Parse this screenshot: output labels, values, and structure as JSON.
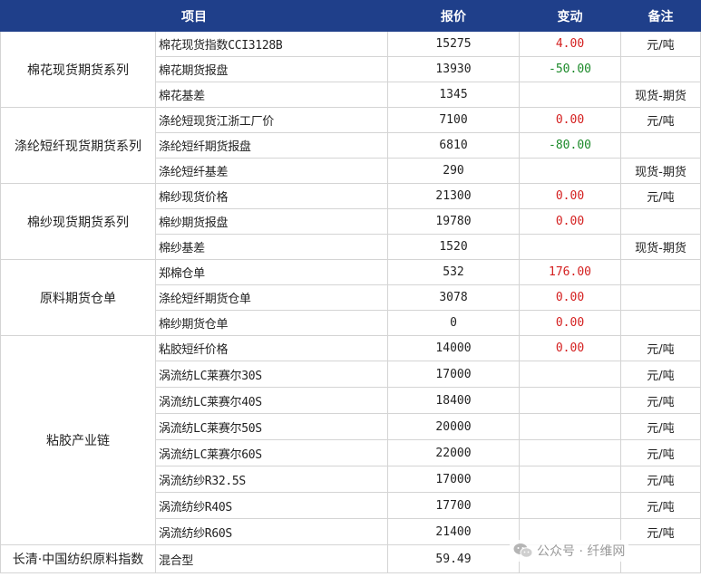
{
  "headers": {
    "item": "项目",
    "price": "报价",
    "change": "变动",
    "note": "备注"
  },
  "groups": [
    {
      "name": "棉花现货期货系列",
      "rows": [
        {
          "item": "棉花现货指数CCI3128B",
          "price": "15275",
          "change": "4.00",
          "change_color": "red",
          "note": "元/吨"
        },
        {
          "item": "棉花期货报盘",
          "price": "13930",
          "change": "-50.00",
          "change_color": "green",
          "note": ""
        },
        {
          "item": "棉花基差",
          "price": "1345",
          "change": "",
          "change_color": "",
          "note": "现货-期货"
        }
      ]
    },
    {
      "name": "涤纶短纤现货期货系列",
      "rows": [
        {
          "item": "涤纶短现货江浙工厂价",
          "price": "7100",
          "change": "0.00",
          "change_color": "red",
          "note": "元/吨"
        },
        {
          "item": "涤纶短纤期货报盘",
          "price": "6810",
          "change": "-80.00",
          "change_color": "green",
          "note": ""
        },
        {
          "item": "涤纶短纤基差",
          "price": "290",
          "change": "",
          "change_color": "",
          "note": "现货-期货"
        }
      ]
    },
    {
      "name": "棉纱现货期货系列",
      "rows": [
        {
          "item": "棉纱现货价格",
          "price": "21300",
          "change": "0.00",
          "change_color": "red",
          "note": "元/吨"
        },
        {
          "item": "棉纱期货报盘",
          "price": "19780",
          "change": "0.00",
          "change_color": "red",
          "note": ""
        },
        {
          "item": "棉纱基差",
          "price": "1520",
          "change": "",
          "change_color": "",
          "note": "现货-期货"
        }
      ]
    },
    {
      "name": "原料期货仓单",
      "rows": [
        {
          "item": "郑棉仓单",
          "price": "532",
          "change": "176.00",
          "change_color": "red",
          "note": ""
        },
        {
          "item": "涤纶短纤期货仓单",
          "price": "3078",
          "change": "0.00",
          "change_color": "red",
          "note": ""
        },
        {
          "item": "棉纱期货仓单",
          "price": "0",
          "change": "0.00",
          "change_color": "red",
          "note": ""
        }
      ]
    },
    {
      "name": "粘胶产业链",
      "rows": [
        {
          "item": "粘胶短纤价格",
          "price": "14000",
          "change": "0.00",
          "change_color": "red",
          "note": "元/吨"
        },
        {
          "item": "涡流纺LC莱赛尔30S",
          "price": "17000",
          "change": "",
          "change_color": "",
          "note": "元/吨"
        },
        {
          "item": "涡流纺LC莱赛尔40S",
          "price": "18400",
          "change": "",
          "change_color": "",
          "note": "元/吨"
        },
        {
          "item": "涡流纺LC莱赛尔50S",
          "price": "20000",
          "change": "",
          "change_color": "",
          "note": "元/吨"
        },
        {
          "item": "涡流纺LC莱赛尔60S",
          "price": "22000",
          "change": "",
          "change_color": "",
          "note": "元/吨"
        },
        {
          "item": "涡流纺纱R32.5S",
          "price": "17000",
          "change": "",
          "change_color": "",
          "note": "元/吨"
        },
        {
          "item": "涡流纺纱R40S",
          "price": "17700",
          "change": "",
          "change_color": "",
          "note": "元/吨"
        },
        {
          "item": "涡流纺纱R60S",
          "price": "21400",
          "change": "",
          "change_color": "",
          "note": "元/吨"
        }
      ]
    }
  ],
  "footer_row": {
    "name": "长清·中国纺织原料指数",
    "item": "混合型",
    "price": "59.49",
    "change": "",
    "note": ""
  },
  "watermark": {
    "text": "公众号 · 纤维网"
  },
  "colors": {
    "header_bg": "#1f3f8a",
    "up": "#d42020",
    "down": "#1c8a2a"
  }
}
